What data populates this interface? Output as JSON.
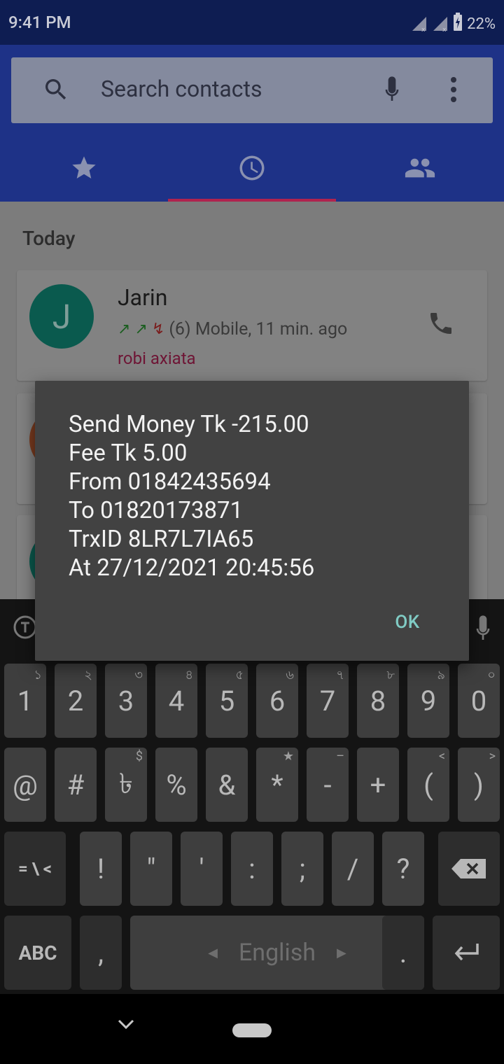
{
  "status_bar": {
    "time": "9:41 PM",
    "battery": "22%"
  },
  "search": {
    "placeholder": "Search contacts"
  },
  "tabs": [
    {
      "name": "favorites",
      "icon": "star-icon"
    },
    {
      "name": "recents",
      "icon": "clock-icon",
      "selected": true
    },
    {
      "name": "contacts",
      "icon": "people-icon"
    }
  ],
  "list": {
    "section_label": "Today",
    "items": [
      {
        "initial": "J",
        "name": "Jarin",
        "detail": "(6) Mobile, 11 min. ago",
        "sim": "robi axiata"
      }
    ]
  },
  "dialog": {
    "lines": [
      "Send Money Tk -215.00",
      "Fee Tk 5.00",
      "From 01842435694",
      "To 01820173871",
      "TrxID 8LR7L7IA65",
      "At 27/12/2021 20:45:56"
    ],
    "ok_label": "OK"
  },
  "keyboard": {
    "row1": [
      {
        "label": "1",
        "hint": "১"
      },
      {
        "label": "2",
        "hint": "২"
      },
      {
        "label": "3",
        "hint": "৩"
      },
      {
        "label": "4",
        "hint": "৪"
      },
      {
        "label": "5",
        "hint": "৫"
      },
      {
        "label": "6",
        "hint": "৬"
      },
      {
        "label": "7",
        "hint": "৭"
      },
      {
        "label": "8",
        "hint": "৮"
      },
      {
        "label": "9",
        "hint": "৯"
      },
      {
        "label": "0",
        "hint": "০"
      }
    ],
    "row2": [
      {
        "label": "@",
        "hint": ""
      },
      {
        "label": "#",
        "hint": ""
      },
      {
        "label": "৳",
        "hint": "$"
      },
      {
        "label": "%",
        "hint": ""
      },
      {
        "label": "&",
        "hint": ""
      },
      {
        "label": "*",
        "hint": "★"
      },
      {
        "label": "-",
        "hint": "–"
      },
      {
        "label": "+",
        "hint": ""
      },
      {
        "label": "(",
        "hint": "<"
      },
      {
        "label": ")",
        "hint": ">"
      }
    ],
    "row3": [
      {
        "label": "= \\ <"
      },
      {
        "label": "!"
      },
      {
        "label": "\""
      },
      {
        "label": "'"
      },
      {
        "label": ":"
      },
      {
        "label": ";"
      },
      {
        "label": "/"
      },
      {
        "label": "?"
      }
    ],
    "abc_label": "ABC",
    "comma_label": ",",
    "space_label": "English",
    "period_label": "."
  }
}
